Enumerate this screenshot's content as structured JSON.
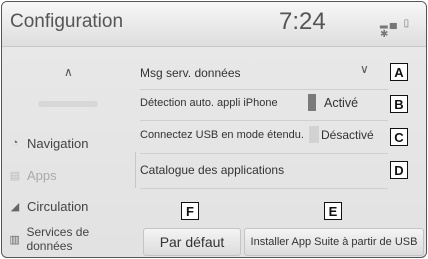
{
  "header": {
    "title": "Configuration",
    "time": "7:24",
    "signal_icon": "signal-icon",
    "phone_icon": "phone-icon",
    "bluetooth_icon": "bluetooth-icon"
  },
  "sidebar": {
    "items": [
      {
        "label": "Navigation",
        "icon": "navigation-icon"
      },
      {
        "label": "Apps",
        "icon": "apps-icon"
      },
      {
        "label": "Circulation",
        "icon": "car-icon"
      },
      {
        "label": "Services de données",
        "icon": "data-services-icon"
      }
    ]
  },
  "settings": {
    "msg_serv": "Msg serv. données",
    "detection_label": "Détection auto. appli iPhone",
    "detection_value": "Activé",
    "usb_label": "Connectez USB en mode étendu.",
    "usb_value": "Désactivé",
    "catalogue": "Catalogue des applications"
  },
  "buttons": {
    "default_label": "Par défaut",
    "install_label": "Installer App Suite à partir de USB"
  },
  "callouts": {
    "a": "A",
    "b": "B",
    "c": "C",
    "d": "D",
    "e": "E",
    "f": "F"
  }
}
